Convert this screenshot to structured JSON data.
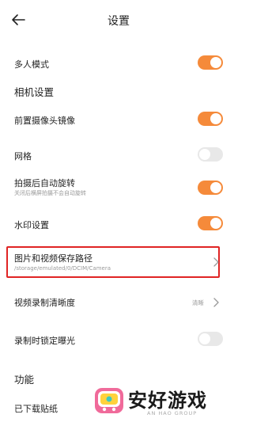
{
  "header": {
    "title": "设置"
  },
  "multi_user": {
    "label": "多人模式",
    "on": true
  },
  "camera_section": {
    "title": "相机设置"
  },
  "front_mirror": {
    "label": "前置摄像头镜像",
    "on": true
  },
  "grid": {
    "label": "网格",
    "on": false
  },
  "auto_rotate": {
    "label": "拍摄后自动旋转",
    "sub": "关闭后横屏拍摄不会自动旋转",
    "on": true
  },
  "watermark": {
    "label": "水印设置",
    "on": true
  },
  "save_path": {
    "label": "图片和视频保存路径",
    "sub": "/storage/emulated/0/DCIM/Camera"
  },
  "video_quality": {
    "label": "视频录制清晰度",
    "value": "清晰"
  },
  "lock_exposure": {
    "label": "录制时锁定曝光",
    "on": false
  },
  "function_section": {
    "title": "功能"
  },
  "stickers": {
    "label": "已下载贴纸"
  },
  "watermark_brand": {
    "name": "安好游戏",
    "sub": "AN HAO GROUP"
  },
  "colors": {
    "accent": "#f58a3a",
    "highlight": "#e02424",
    "toggle_off": "#e8e8e8"
  }
}
